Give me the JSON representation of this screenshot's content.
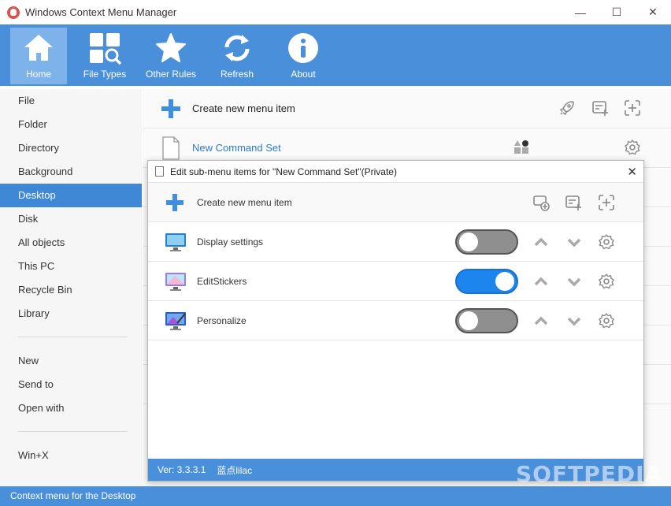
{
  "window": {
    "title": "Windows Context Menu Manager",
    "minimize": "—",
    "maximize": "☐",
    "close": "✕"
  },
  "toolbar": [
    {
      "label": "Home",
      "icon": "home-icon",
      "active": true
    },
    {
      "label": "File Types",
      "icon": "file-types-icon"
    },
    {
      "label": "Other Rules",
      "icon": "star-icon"
    },
    {
      "label": "Refresh",
      "icon": "refresh-icon"
    },
    {
      "label": "About",
      "icon": "info-icon"
    }
  ],
  "sidebar": {
    "items": [
      "File",
      "Folder",
      "Directory",
      "Background",
      "Desktop",
      "Disk",
      "All objects",
      "This PC",
      "Recycle Bin",
      "Library"
    ],
    "items2": [
      "New",
      "Send to",
      "Open with"
    ],
    "items3": [
      "Win+X"
    ],
    "active": "Desktop"
  },
  "main": {
    "create_label": "Create new menu item",
    "rows": [
      {
        "label": "New Command Set",
        "enabled": true
      }
    ]
  },
  "dialog": {
    "title": "Edit sub-menu items for \"New Command Set\"(Private)",
    "close": "✕",
    "create_label": "Create new menu item",
    "items": [
      {
        "label": "Display settings",
        "enabled": false,
        "icon": "display-settings-icon"
      },
      {
        "label": "EditStickers",
        "enabled": true,
        "icon": "edit-stickers-icon"
      },
      {
        "label": "Personalize",
        "enabled": false,
        "icon": "personalize-icon"
      }
    ],
    "version": "Ver: 3.3.3.1",
    "author": "蓝点lilac"
  },
  "statusbar": {
    "text": "Context menu for the Desktop"
  },
  "watermark": "SOFTPEDIA",
  "colors": {
    "accent": "#4a8fd9",
    "selected": "#3e88d6",
    "toggle_on": "#1c86ee",
    "toggle_off": "#8f8f8f"
  }
}
